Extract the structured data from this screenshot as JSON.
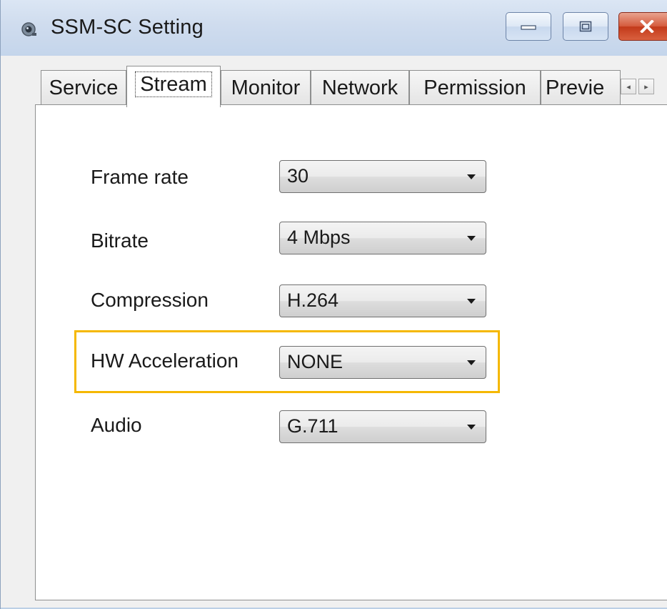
{
  "window": {
    "title": "SSM-SC Setting",
    "app_icon": "camera-icon",
    "controls": {
      "minimize_icon": "minimize-icon",
      "maximize_icon": "maximize-icon",
      "close_icon": "close-icon",
      "close_color": "#c23a1a"
    }
  },
  "tabs": [
    {
      "label": "Service",
      "active": false
    },
    {
      "label": "Stream",
      "active": true
    },
    {
      "label": "Monitor",
      "active": false
    },
    {
      "label": "Network",
      "active": false
    },
    {
      "label": "Permission",
      "active": false
    },
    {
      "label": "Previe",
      "active": false
    }
  ],
  "tab_scroll": {
    "left": "◂",
    "right": "▸"
  },
  "stream": {
    "fields": [
      {
        "label": "Frame rate",
        "value": "30"
      },
      {
        "label": "Bitrate",
        "value": "4 Mbps"
      },
      {
        "label": "Compression",
        "value": "H.264"
      },
      {
        "label": "HW Acceleration",
        "value": "NONE",
        "highlighted": true
      },
      {
        "label": "Audio",
        "value": "G.711"
      }
    ],
    "highlight_color": "#f5b800"
  }
}
